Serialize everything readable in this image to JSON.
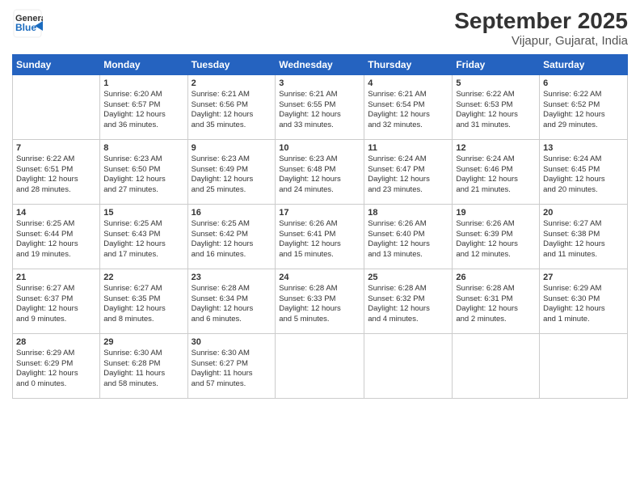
{
  "logo": {
    "line1": "General",
    "line2": "Blue"
  },
  "title": "September 2025",
  "subtitle": "Vijapur, Gujarat, India",
  "days_header": [
    "Sunday",
    "Monday",
    "Tuesday",
    "Wednesday",
    "Thursday",
    "Friday",
    "Saturday"
  ],
  "weeks": [
    [
      {
        "day": "",
        "info": ""
      },
      {
        "day": "1",
        "info": "Sunrise: 6:20 AM\nSunset: 6:57 PM\nDaylight: 12 hours\nand 36 minutes."
      },
      {
        "day": "2",
        "info": "Sunrise: 6:21 AM\nSunset: 6:56 PM\nDaylight: 12 hours\nand 35 minutes."
      },
      {
        "day": "3",
        "info": "Sunrise: 6:21 AM\nSunset: 6:55 PM\nDaylight: 12 hours\nand 33 minutes."
      },
      {
        "day": "4",
        "info": "Sunrise: 6:21 AM\nSunset: 6:54 PM\nDaylight: 12 hours\nand 32 minutes."
      },
      {
        "day": "5",
        "info": "Sunrise: 6:22 AM\nSunset: 6:53 PM\nDaylight: 12 hours\nand 31 minutes."
      },
      {
        "day": "6",
        "info": "Sunrise: 6:22 AM\nSunset: 6:52 PM\nDaylight: 12 hours\nand 29 minutes."
      }
    ],
    [
      {
        "day": "7",
        "info": "Sunrise: 6:22 AM\nSunset: 6:51 PM\nDaylight: 12 hours\nand 28 minutes."
      },
      {
        "day": "8",
        "info": "Sunrise: 6:23 AM\nSunset: 6:50 PM\nDaylight: 12 hours\nand 27 minutes."
      },
      {
        "day": "9",
        "info": "Sunrise: 6:23 AM\nSunset: 6:49 PM\nDaylight: 12 hours\nand 25 minutes."
      },
      {
        "day": "10",
        "info": "Sunrise: 6:23 AM\nSunset: 6:48 PM\nDaylight: 12 hours\nand 24 minutes."
      },
      {
        "day": "11",
        "info": "Sunrise: 6:24 AM\nSunset: 6:47 PM\nDaylight: 12 hours\nand 23 minutes."
      },
      {
        "day": "12",
        "info": "Sunrise: 6:24 AM\nSunset: 6:46 PM\nDaylight: 12 hours\nand 21 minutes."
      },
      {
        "day": "13",
        "info": "Sunrise: 6:24 AM\nSunset: 6:45 PM\nDaylight: 12 hours\nand 20 minutes."
      }
    ],
    [
      {
        "day": "14",
        "info": "Sunrise: 6:25 AM\nSunset: 6:44 PM\nDaylight: 12 hours\nand 19 minutes."
      },
      {
        "day": "15",
        "info": "Sunrise: 6:25 AM\nSunset: 6:43 PM\nDaylight: 12 hours\nand 17 minutes."
      },
      {
        "day": "16",
        "info": "Sunrise: 6:25 AM\nSunset: 6:42 PM\nDaylight: 12 hours\nand 16 minutes."
      },
      {
        "day": "17",
        "info": "Sunrise: 6:26 AM\nSunset: 6:41 PM\nDaylight: 12 hours\nand 15 minutes."
      },
      {
        "day": "18",
        "info": "Sunrise: 6:26 AM\nSunset: 6:40 PM\nDaylight: 12 hours\nand 13 minutes."
      },
      {
        "day": "19",
        "info": "Sunrise: 6:26 AM\nSunset: 6:39 PM\nDaylight: 12 hours\nand 12 minutes."
      },
      {
        "day": "20",
        "info": "Sunrise: 6:27 AM\nSunset: 6:38 PM\nDaylight: 12 hours\nand 11 minutes."
      }
    ],
    [
      {
        "day": "21",
        "info": "Sunrise: 6:27 AM\nSunset: 6:37 PM\nDaylight: 12 hours\nand 9 minutes."
      },
      {
        "day": "22",
        "info": "Sunrise: 6:27 AM\nSunset: 6:35 PM\nDaylight: 12 hours\nand 8 minutes."
      },
      {
        "day": "23",
        "info": "Sunrise: 6:28 AM\nSunset: 6:34 PM\nDaylight: 12 hours\nand 6 minutes."
      },
      {
        "day": "24",
        "info": "Sunrise: 6:28 AM\nSunset: 6:33 PM\nDaylight: 12 hours\nand 5 minutes."
      },
      {
        "day": "25",
        "info": "Sunrise: 6:28 AM\nSunset: 6:32 PM\nDaylight: 12 hours\nand 4 minutes."
      },
      {
        "day": "26",
        "info": "Sunrise: 6:28 AM\nSunset: 6:31 PM\nDaylight: 12 hours\nand 2 minutes."
      },
      {
        "day": "27",
        "info": "Sunrise: 6:29 AM\nSunset: 6:30 PM\nDaylight: 12 hours\nand 1 minute."
      }
    ],
    [
      {
        "day": "28",
        "info": "Sunrise: 6:29 AM\nSunset: 6:29 PM\nDaylight: 12 hours\nand 0 minutes."
      },
      {
        "day": "29",
        "info": "Sunrise: 6:30 AM\nSunset: 6:28 PM\nDaylight: 11 hours\nand 58 minutes."
      },
      {
        "day": "30",
        "info": "Sunrise: 6:30 AM\nSunset: 6:27 PM\nDaylight: 11 hours\nand 57 minutes."
      },
      {
        "day": "",
        "info": ""
      },
      {
        "day": "",
        "info": ""
      },
      {
        "day": "",
        "info": ""
      },
      {
        "day": "",
        "info": ""
      }
    ]
  ]
}
